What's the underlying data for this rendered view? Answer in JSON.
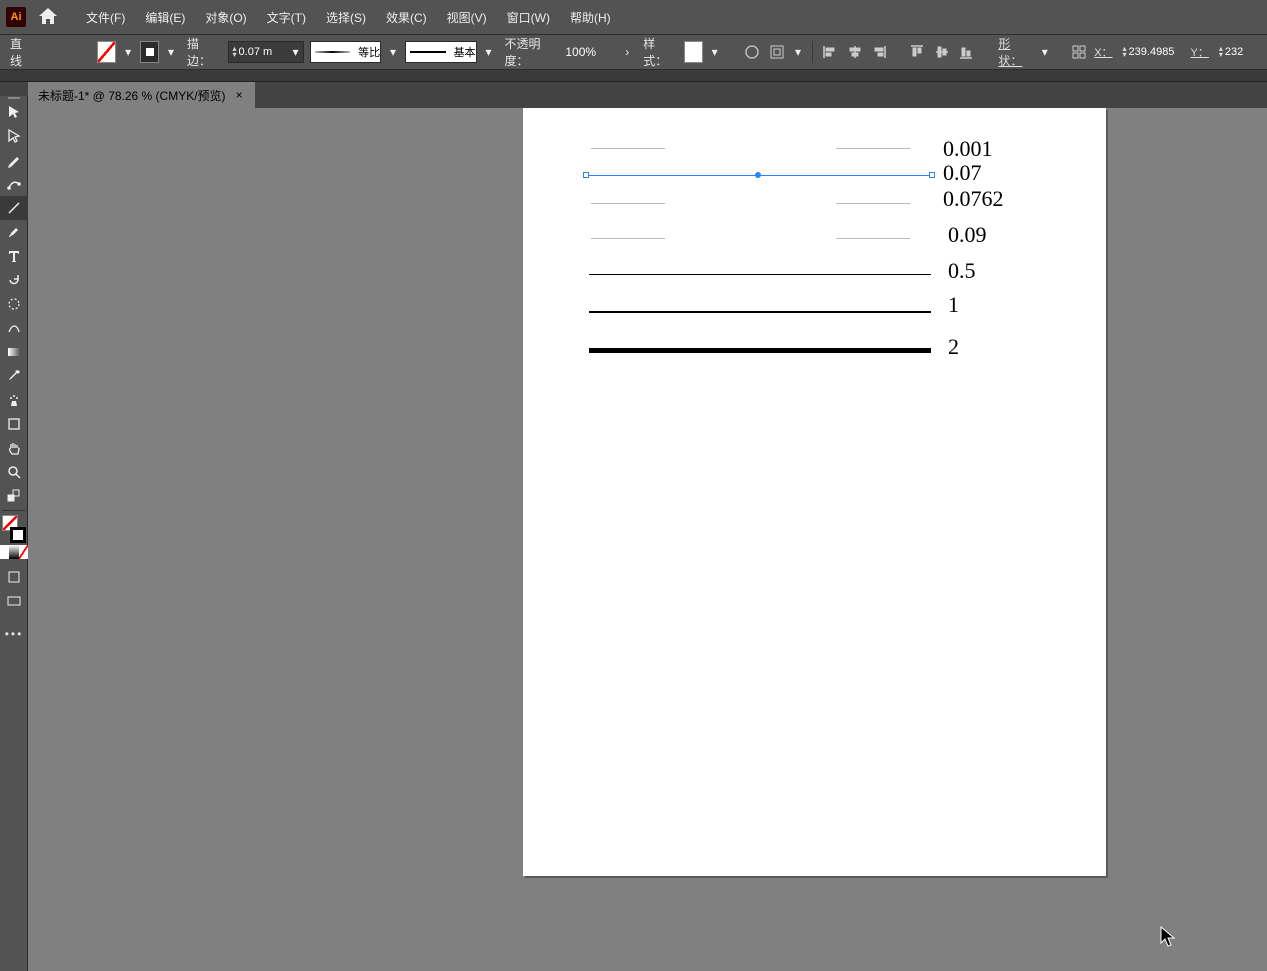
{
  "menubar": {
    "items": [
      "文件(F)",
      "编辑(E)",
      "对象(O)",
      "文字(T)",
      "选择(S)",
      "效果(C)",
      "视图(V)",
      "窗口(W)",
      "帮助(H)"
    ]
  },
  "optbar": {
    "tool_name": "直线",
    "stroke_label": "描边：",
    "stroke_value": "0.07 m",
    "brush1_label": "等比",
    "brush2_label": "基本",
    "opacity_label": "不透明度：",
    "opacity_value": "100%",
    "style_label": "样式：",
    "shape_label": "形状：",
    "x_label": "X：",
    "x_value": "239.4985",
    "y_label": "Y：",
    "y_value": "232"
  },
  "doctab": {
    "title": "未标题-1* @ 78.26 % (CMYK/预览)",
    "close": "×"
  },
  "canvas": {
    "labels": [
      "0.001",
      "0.07",
      "0.0762",
      "0.09",
      "0.5",
      "1",
      "2"
    ]
  }
}
